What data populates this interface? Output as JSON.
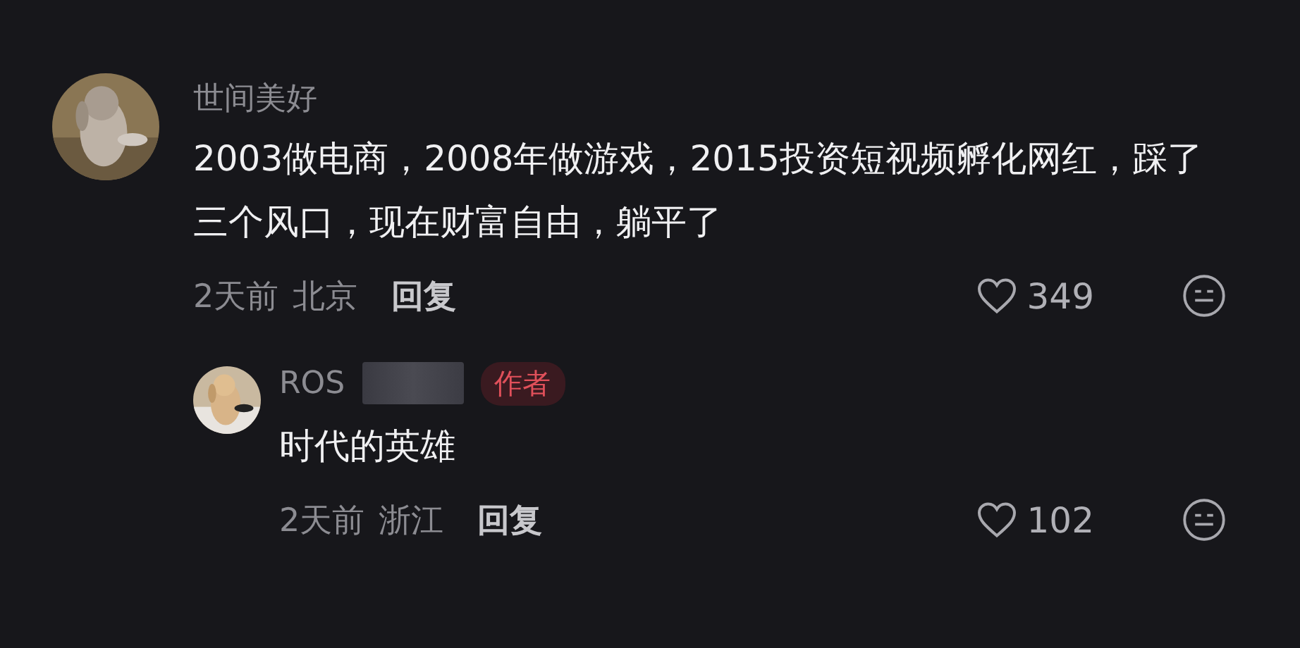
{
  "comments": [
    {
      "kind": "comment",
      "author": "世间美好",
      "text": "2003做电商，2008年做游戏，2015投资短视频孵化网红，踩了三个风口，现在财富自由，躺平了",
      "time": "2天前",
      "location": "北京",
      "reply": "回复",
      "likes": "349"
    },
    {
      "kind": "reply",
      "author": "ROS",
      "redacted": true,
      "badge": "作者",
      "text": "时代的英雄",
      "time": "2天前",
      "location": "浙江",
      "reply": "回复",
      "likes": "102"
    }
  ]
}
